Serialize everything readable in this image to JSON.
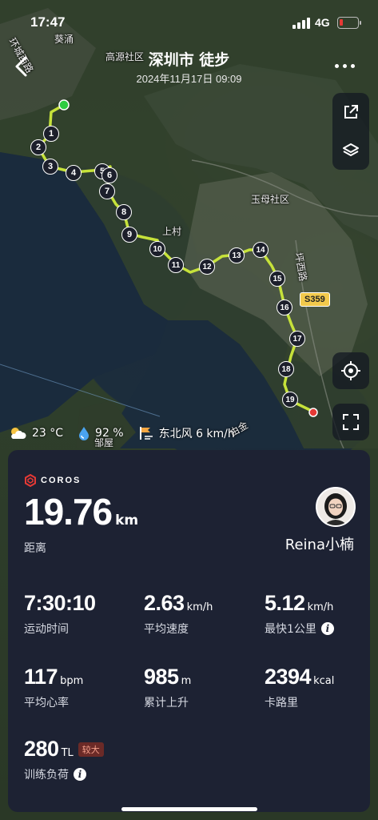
{
  "status_bar": {
    "time": "17:47",
    "network": "4G"
  },
  "header": {
    "title": "深圳市 徒步",
    "datetime": "2024年11月17日 09:09"
  },
  "map": {
    "labels": {
      "a": "葵涌",
      "b": "高源社区",
      "c": "环城西路",
      "d": "玉母社区",
      "e": "上村",
      "f": "坪西路",
      "g": "邹屋",
      "h": "由金"
    },
    "road_badge": "S359",
    "km_markers": [
      "1",
      "2",
      "3",
      "4",
      "5",
      "6",
      "7",
      "8",
      "9",
      "10",
      "11",
      "12",
      "13",
      "14",
      "15",
      "16",
      "17",
      "18",
      "19"
    ]
  },
  "weather": {
    "temperature": "23 °C",
    "humidity": "92 %",
    "wind": "东北风 6 km/h"
  },
  "card": {
    "brand": "COROS",
    "distance_value": "19.76",
    "distance_unit": "km",
    "distance_label": "距离",
    "username": "Reina小楠",
    "stats": {
      "duration": {
        "value": "7:30:10",
        "unit": "",
        "label": "运动时间"
      },
      "avg_speed": {
        "value": "2.63",
        "unit": "km/h",
        "label": "平均速度"
      },
      "fastest_km": {
        "value": "5.12",
        "unit": "km/h",
        "label": "最快1公里"
      },
      "avg_hr": {
        "value": "117",
        "unit": "bpm",
        "label": "平均心率"
      },
      "ascent": {
        "value": "985",
        "unit": "m",
        "label": "累计上升"
      },
      "calories": {
        "value": "2394",
        "unit": "kcal",
        "label": "卡路里"
      },
      "training_load": {
        "value": "280",
        "unit": "TL",
        "label": "训练负荷",
        "tag": "较大"
      }
    }
  },
  "colors": {
    "route": "#c6e23a",
    "start": "#2ecc40",
    "end": "#e53935",
    "card_bg": "#1d2233",
    "tag_bg": "#6b2a27"
  },
  "icons": [
    "back-icon",
    "share-icon",
    "layers-icon",
    "locate-icon",
    "fullscreen-icon",
    "more-icon",
    "weather-icon",
    "humidity-icon",
    "wind-icon",
    "info-icon",
    "coros-logo-icon"
  ]
}
